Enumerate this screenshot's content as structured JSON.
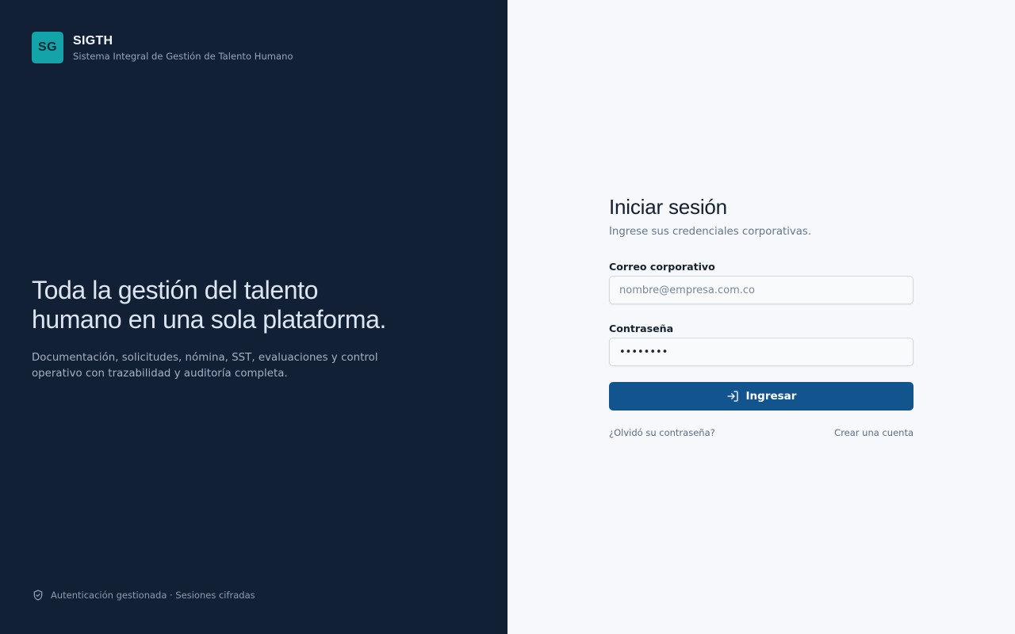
{
  "brand": {
    "logo_initials": "SG",
    "app_name": "SIGTH",
    "app_subtitle": "Sistema Integral de Gestión de Talento Humano",
    "hero_title_line1": "Toda la gestión del talento",
    "hero_title_line2": "humano en una sola plataforma.",
    "hero_description": "Documentación, solicitudes, nómina, SST, evaluaciones y control operativo con trazabilidad y auditoría completa.",
    "footer_icon": "shield-check-icon",
    "footer_text": "Autenticación gestionada · Sesiones cifradas"
  },
  "login": {
    "title": "Iniciar sesión",
    "subtitle": "Ingrese sus credenciales corporativas.",
    "email_label": "Correo corporativo",
    "email_placeholder": "nombre@empresa.com.co",
    "email_value": "",
    "password_label": "Contraseña",
    "password_value": "pppppppp",
    "submit_label": "Ingresar",
    "submit_icon": "log-in-icon",
    "forgot_link": "¿Olvidó su contraseña?",
    "create_account_link": "Crear una cuenta"
  },
  "colors": {
    "brand_panel_bg": "#112035",
    "logo_accent": "#14a3a8",
    "primary_button": "#12548d",
    "login_panel_bg": "#f6f8fb"
  }
}
